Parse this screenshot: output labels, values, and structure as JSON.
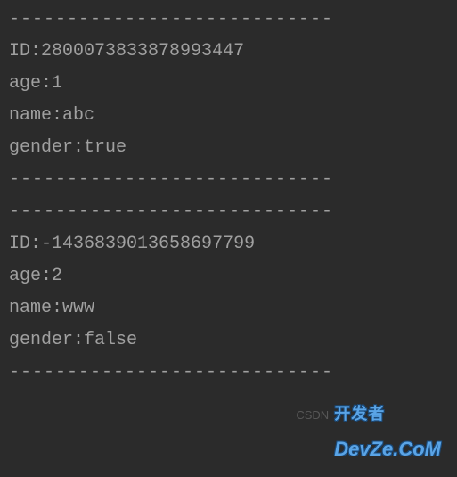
{
  "divider": "----------------------------",
  "records": [
    {
      "ID": "2800073833878993447",
      "age": "1",
      "name": "abc",
      "gender": "true"
    },
    {
      "ID": "-1436839013658697799",
      "age": "2",
      "name": "www",
      "gender": "false"
    }
  ],
  "labels": {
    "id": "ID",
    "age": "age",
    "name": "name",
    "gender": "gender"
  },
  "watermark": {
    "csdn": "CSDN",
    "cn": "开发者",
    "en": "DevZe.CoM"
  }
}
